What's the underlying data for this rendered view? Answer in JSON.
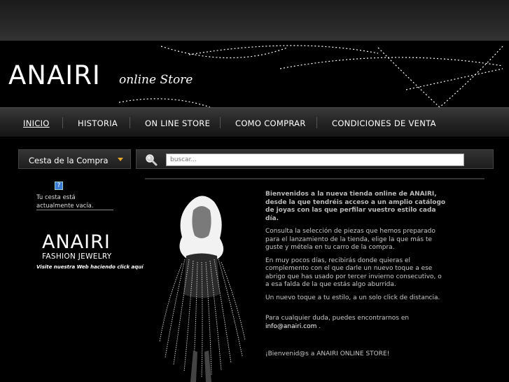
{
  "header": {
    "logo_text": "ANAIRI",
    "logo_sub": "online Store"
  },
  "nav": {
    "items": [
      {
        "label": "INICIO"
      },
      {
        "label": "HISTORIA"
      },
      {
        "label": "ON LINE STORE"
      },
      {
        "label": "COMO COMPRAR"
      },
      {
        "label": "CONDICIONES DE VENTA"
      }
    ]
  },
  "cart": {
    "label": "Cesta de la Compra",
    "help_glyph": "?",
    "empty_text": "Tu cesta está actualmente vacía."
  },
  "search": {
    "placeholder": "buscar..."
  },
  "promo": {
    "brand": "ANAIRI",
    "sub": "FASHION JEWELRY",
    "link": "Visite nuestra Web haciendo click aquí"
  },
  "content": {
    "intro": "Bienvenidos a la nueva tienda online de ANAIRI, desde la que tendréis acceso a un amplio catálogo de joyas con las que perfilar vuestro estilo cada día.",
    "p1": "Consulta la selección de piezas que hemos preparado para el lanzamiento de la tienda, elige la que más te guste y métela en tu carro de la compra.",
    "p2": "En muy pocos días, recibirás donde quieras el complemento con el que darle un nuevo toque a ese abrigo que has usado por tercer invierno consecutivo, o a esa falda de la que estás algo aburrida.",
    "p3": "Un nuevo toque a tu estilo, a un solo click de distancia.",
    "p4": "Para cualquier duda, puedes encontrarnos en",
    "email": "info@anairi.com",
    "email_suffix": " .",
    "p5": "¡Bienvenid@s a ANAIRI ONLINE STORE!"
  },
  "colors": {
    "accent": "#e6a72a",
    "background": "#000000"
  }
}
